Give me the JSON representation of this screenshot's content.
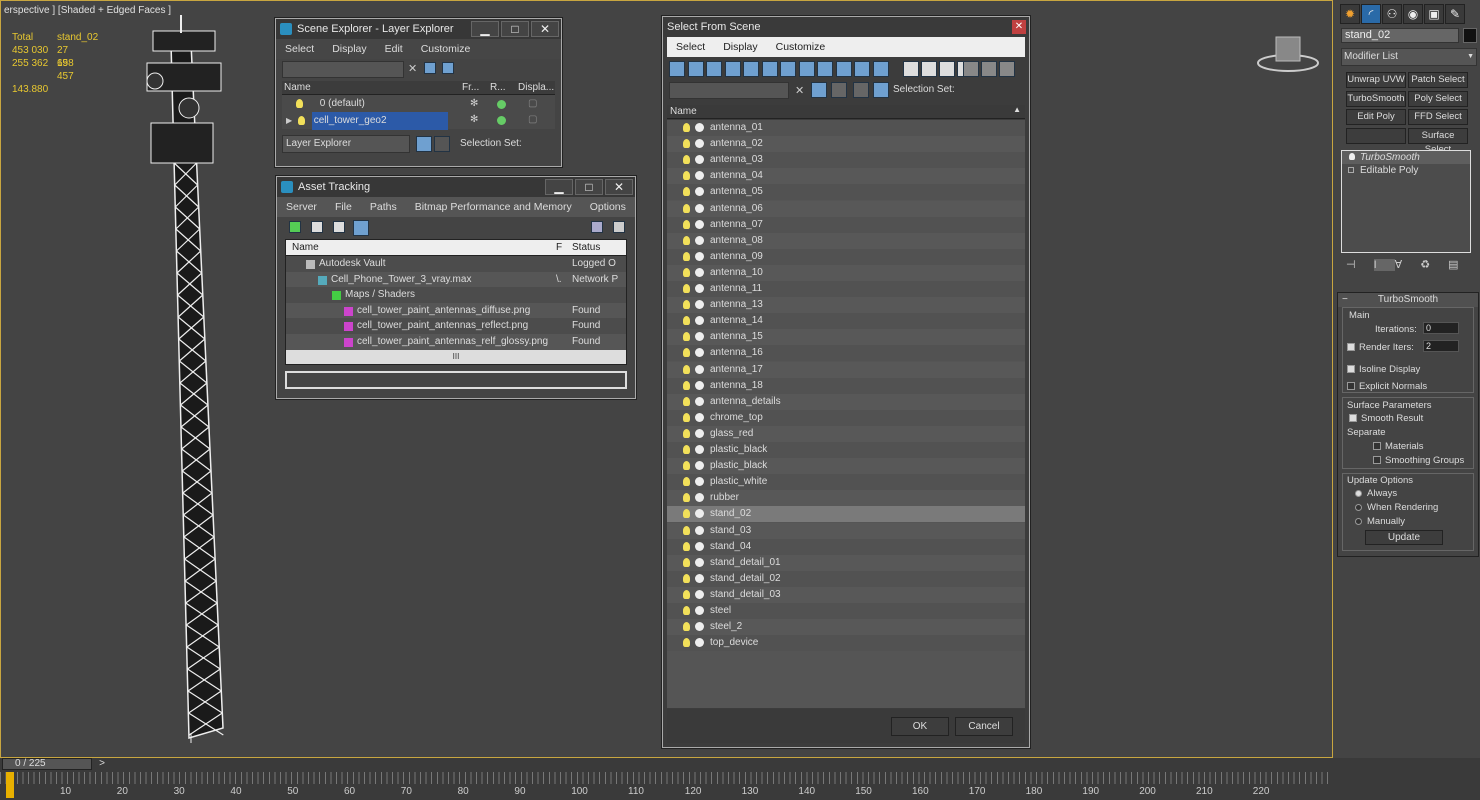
{
  "viewport": {
    "label": "erspective ] [Shaded + Edged Faces ]",
    "stats": {
      "header": [
        "Total",
        "stand_02"
      ],
      "rows": [
        [
          "453 030",
          "27 698"
        ],
        [
          "255 362",
          "15 457"
        ]
      ],
      "fps": "143.880"
    }
  },
  "layer_explorer": {
    "title": "Scene Explorer - Layer Explorer",
    "minimize": "▁",
    "maximize": "□",
    "close": "✕",
    "menu": [
      "Select",
      "Display",
      "Edit",
      "Customize"
    ],
    "columns": [
      "Name",
      "Fr...",
      "R...",
      "Displa..."
    ],
    "layers": [
      "0 (default)",
      "cell_tower_geo2"
    ],
    "footer_select": "Layer Explorer",
    "selection_set": "Selection Set:"
  },
  "asset_tracking": {
    "title": "Asset Tracking",
    "minimize": "▁",
    "maximize": "□",
    "close": "✕",
    "menu": [
      "Server",
      "File",
      "Paths",
      "Bitmap Performance and Memory",
      "Options"
    ],
    "columns": [
      "Name",
      "F",
      "Status"
    ],
    "rows": [
      {
        "name": "Autodesk Vault",
        "f": "",
        "status": "Logged O"
      },
      {
        "name": "Cell_Phone_Tower_3_vray.max",
        "f": "\\.",
        "status": "Network P"
      },
      {
        "name": "Maps / Shaders",
        "f": "",
        "status": ""
      },
      {
        "name": "cell_tower_paint_antennas_diffuse.png",
        "f": "",
        "status": "Found"
      },
      {
        "name": "cell_tower_paint_antennas_reflect.png",
        "f": "",
        "status": "Found"
      },
      {
        "name": "cell_tower_paint_antennas_relf_glossy.png",
        "f": "",
        "status": "Found"
      }
    ],
    "scroll_grip": "III"
  },
  "select_from_scene": {
    "title": "Select From Scene",
    "close": "✕",
    "menu": [
      "Select",
      "Display",
      "Customize"
    ],
    "selection_set": "Selection Set:",
    "column": "Name",
    "objects": [
      "antenna_01",
      "antenna_02",
      "antenna_03",
      "antenna_04",
      "antenna_05",
      "antenna_06",
      "antenna_07",
      "antenna_08",
      "antenna_09",
      "antenna_10",
      "antenna_11",
      "antenna_13",
      "antenna_14",
      "antenna_15",
      "antenna_16",
      "antenna_17",
      "antenna_18",
      "antenna_details",
      "chrome_top",
      "glass_red",
      "plastic_black",
      "plastic_black",
      "plastic_white",
      "rubber",
      "stand_02",
      "stand_03",
      "stand_04",
      "stand_detail_01",
      "stand_detail_02",
      "stand_detail_03",
      "steel",
      "steel_2",
      "top_device"
    ],
    "selected_index": 24,
    "ok": "OK",
    "cancel": "Cancel"
  },
  "command_panel": {
    "object_name": "stand_02",
    "modifier_list": "Modifier List",
    "buttons": [
      [
        "Unwrap UVW",
        "Patch Select"
      ],
      [
        "TurboSmooth",
        "Poly Select"
      ],
      [
        "Edit Poly",
        "FFD Select"
      ],
      [
        "",
        "Surface Select"
      ]
    ],
    "stack": [
      "TurboSmooth",
      "Editable Poly"
    ],
    "rollout_title": "TurboSmooth",
    "main_label": "Main",
    "iterations_label": "Iterations:",
    "iterations_value": "0",
    "render_iters_label": "Render Iters:",
    "render_iters_value": "2",
    "isoline": "Isoline Display",
    "explicit_normals": "Explicit Normals",
    "surface_params": "Surface Parameters",
    "smooth_result": "Smooth Result",
    "separate": "Separate",
    "materials": "Materials",
    "smoothing_groups": "Smoothing Groups",
    "update_options": "Update Options",
    "always": "Always",
    "when_rendering": "When Rendering",
    "manually": "Manually",
    "update_button": "Update"
  },
  "timeline": {
    "frame": "0 / 225",
    "next": ">",
    "ticks": [
      "10",
      "20",
      "30",
      "40",
      "50",
      "60",
      "70",
      "80",
      "90",
      "100",
      "110",
      "120",
      "130",
      "140",
      "150",
      "160",
      "170",
      "180",
      "190",
      "200",
      "210",
      "220"
    ]
  }
}
